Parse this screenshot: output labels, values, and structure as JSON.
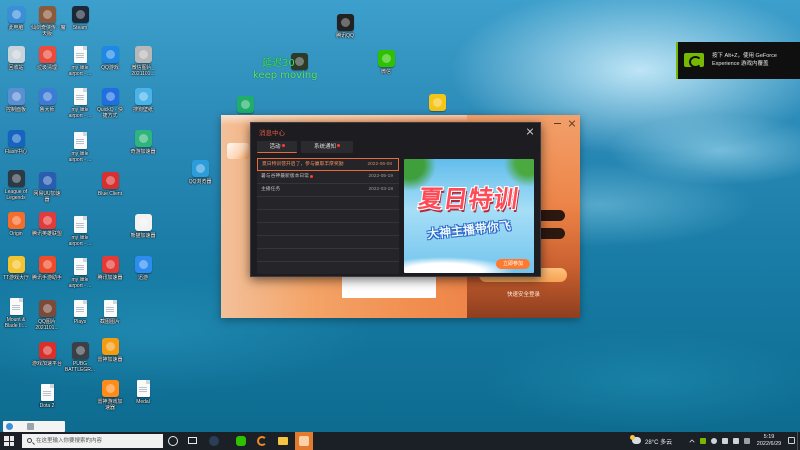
{
  "desktop": {
    "icons": [
      {
        "label": [
          "此电脑"
        ],
        "icon": "computer-icon",
        "color": "#3b8fd9"
      },
      {
        "label": [
          "回收站"
        ],
        "icon": "recycle-bin-icon",
        "color": "#c9d3da"
      },
      {
        "label": [
          "控制面板"
        ],
        "icon": "control-panel-icon",
        "color": "#5b8fd4"
      },
      {
        "label": [
          "Flash中心"
        ],
        "icon": "flash-icon",
        "color": "#1565c0"
      },
      {
        "label": [
          "League of",
          "Legends"
        ],
        "icon": "league-of-legends-icon",
        "color": "#2b3a44"
      },
      {
        "label": [
          "Origin"
        ],
        "icon": "origin-icon",
        "color": "#f56c2d"
      },
      {
        "label": [
          "TT游戏大厅"
        ],
        "icon": "tt-icon",
        "color": "#f4c430"
      },
      {
        "label": [
          "Mount &",
          "Blade II:..."
        ],
        "icon": "document-icon"
      },
      {
        "label": [
          "仙剑奇侠传 · 魔",
          "天版"
        ],
        "icon": "game-icon",
        "color": "#8a5a3c"
      },
      {
        "label": [
          "垃圾清理"
        ],
        "icon": "cleaner-icon",
        "color": "#e94b3c"
      },
      {
        "label": [
          "鲁大师"
        ],
        "icon": "ludashi-icon",
        "color": "#3d7bd6"
      },
      {
        "label": [
          "网易UU加速",
          "器"
        ],
        "icon": "uu-accelerator-icon",
        "color": "#2a5db0"
      },
      {
        "label": [
          "腾讯英雄联盟"
        ],
        "icon": "lol-icon",
        "color": "#e33b3b"
      },
      {
        "label": [
          "腾讯手游助手"
        ],
        "icon": "mobile-game-icon",
        "color": "#ee4b2b"
      },
      {
        "label": [
          "QQ图片",
          "2021101..."
        ],
        "icon": "image-icon",
        "color": "#7b4a3a"
      },
      {
        "label": [
          "游戏加速平台"
        ],
        "icon": "accelerator-icon",
        "color": "#d9302c"
      },
      {
        "label": [
          "Dota 2"
        ],
        "icon": "document-icon"
      },
      {
        "label": [
          "Steam"
        ],
        "icon": "steam-icon",
        "color": "#1b2838"
      },
      {
        "label": [
          "my little",
          "airport - ..."
        ],
        "icon": "document-icon"
      },
      {
        "label": [
          "my little",
          "airport - ..."
        ],
        "icon": "document-icon"
      },
      {
        "label": [
          "my little",
          "airport - ..."
        ],
        "icon": "document-icon"
      },
      {
        "label": [
          "my little",
          "airport - ..."
        ],
        "icon": "document-icon"
      },
      {
        "label": [
          "my little",
          "airport - ..."
        ],
        "icon": "document-icon"
      },
      {
        "label": [
          "Plays"
        ],
        "icon": "document-icon"
      },
      {
        "label": [
          "PUBG",
          "BATTLEGR..."
        ],
        "icon": "pubg-icon",
        "color": "#3b3f46"
      },
      {
        "label": [
          "QQ游戏"
        ],
        "icon": "qq-game-icon",
        "color": "#1e88e5"
      },
      {
        "label": [
          "QuickQ - 快",
          "捷方式"
        ],
        "icon": "quickq-icon",
        "color": "#1f6fe0"
      },
      {
        "label": [
          "Blue Client"
        ],
        "icon": "blue-client-icon",
        "color": "#d63031"
      },
      {
        "label": [
          "腾讯加速器"
        ],
        "icon": "accelerator-icon",
        "color": "#e53935"
      },
      {
        "label": [
          "截图图片"
        ],
        "icon": "document-icon"
      },
      {
        "label": [
          "雷神加速器"
        ],
        "icon": "thunder-accelerator-icon",
        "color": "#f39c12"
      },
      {
        "label": [
          "雷神游戏加",
          "速器"
        ],
        "icon": "thunder-accelerator-icon",
        "color": "#ff8c1a"
      },
      {
        "label": [
          "微信图片_",
          "2021101..."
        ],
        "icon": "image-icon",
        "color": "#b8b8b8"
      },
      {
        "label": [
          "搜狗壁纸"
        ],
        "icon": "wallpaper-icon",
        "color": "#4ab3e8"
      },
      {
        "label": [
          "奇游加速器"
        ],
        "icon": "qiyou-icon",
        "color": "#2fb47c"
      },
      {
        "label": [
          "熊猫加速器"
        ],
        "icon": "panda-icon",
        "color": "#f2f2f2"
      },
      {
        "label": [
          "迅游"
        ],
        "icon": "plane-icon",
        "color": "#2d8cf0"
      },
      {
        "label": [
          "Medal"
        ],
        "icon": "document-icon"
      },
      {
        "label": [
          "QQ浏览器"
        ],
        "icon": "qq-browser-icon",
        "color": "#2d9cdb"
      },
      {
        "label": [
          "腾讯QQ"
        ],
        "icon": "qq-icon",
        "color": "#222222"
      },
      {
        "label": [
          "微信"
        ],
        "icon": "wechat-icon",
        "color": "#2dc100"
      },
      {
        "label": [],
        "icon": "pet-icon",
        "color": "#f5c518"
      },
      {
        "label": [],
        "icon": "app-icon",
        "color": "#1fae6a"
      },
      {
        "label": [],
        "icon": "latency-icon",
        "color": "#2c3a2a"
      }
    ]
  },
  "overlay": {
    "ping": "延迟30",
    "motto": "keep moving"
  },
  "geforce": {
    "line1": "按下 Alt+Z，使用 GeForce",
    "line2": "Experience 游戏内覆盖",
    "accent": "#76b900"
  },
  "launcher": {
    "quick_login": "快速安全登录"
  },
  "message_center": {
    "title": "消息中心",
    "tabs": [
      {
        "label": "活动",
        "active": true
      },
      {
        "label": "系统通知",
        "active": false
      }
    ],
    "items": [
      {
        "title": "夏日特训营开启了，参与赢取丰厚奖励",
        "date": "2022-06-08",
        "selected": true
      },
      {
        "title": "暑与谷神最新版本日常",
        "date": "2022-05-19",
        "selected": false
      },
      {
        "title": "主播任务",
        "date": "2022-03-18",
        "selected": false
      }
    ],
    "banner": {
      "title": "夏日特训",
      "subtitle": "大神主播带你飞",
      "button": "立即参加"
    }
  },
  "taskbar": {
    "search_placeholder": "在这里输入你要搜索的内容",
    "weather": "28°C 多云",
    "time": "5:19",
    "date": "2022/6/29"
  },
  "colors": {
    "accent": "#e8693a",
    "unread_dot": "#ff3b30",
    "taskbar": "#1b2027"
  }
}
